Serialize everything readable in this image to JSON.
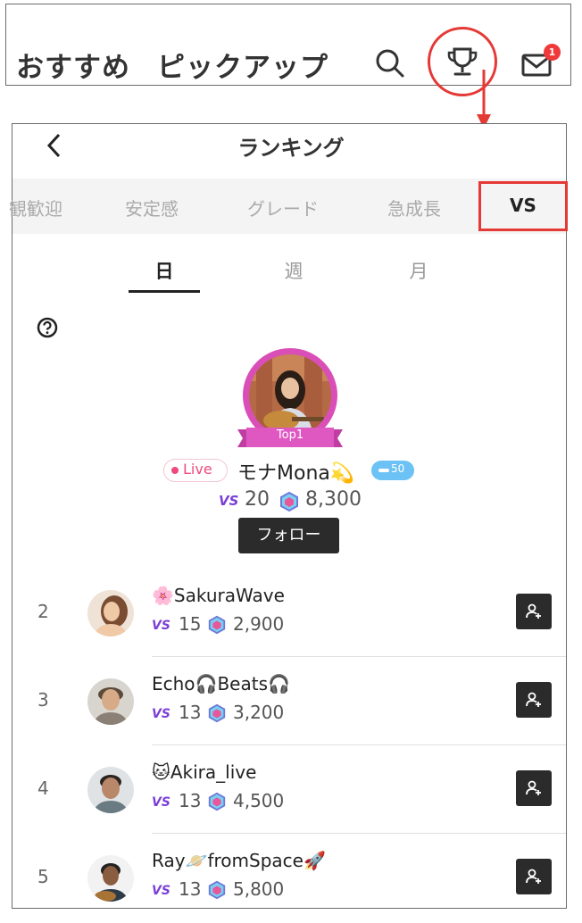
{
  "top_nav": {
    "recommend": "おすすめ",
    "pickup": "ピックアップ",
    "mail_badge": "1"
  },
  "ranking": {
    "title": "ランキング"
  },
  "categories": [
    "観歓迎",
    "安定感",
    "グレード",
    "急成長",
    "VS"
  ],
  "periods": [
    "日",
    "週",
    "月"
  ],
  "top1": {
    "ribbon": "Top1",
    "live": "Live",
    "name": "モナMona💫",
    "level": "50",
    "vs_label": "VS",
    "vs_count": "20",
    "points": "8,300",
    "follow": "フォロー"
  },
  "list": [
    {
      "rank": "2",
      "name": "🌸SakuraWave",
      "vs": "15",
      "points": "2,900"
    },
    {
      "rank": "3",
      "name": "Echo🎧Beats🎧",
      "vs": "13",
      "points": "3,200"
    },
    {
      "rank": "4",
      "name": "🐱Akira_live",
      "vs": "13",
      "points": "4,500"
    },
    {
      "rank": "5",
      "name": "Ray🪐fromSpace🚀",
      "vs": "13",
      "points": "5,800"
    }
  ],
  "colors": {
    "highlight": "#e53935",
    "vs_purple": "#7b3fd6",
    "live_pink": "#f0487d",
    "ring": "#d94fb7"
  }
}
